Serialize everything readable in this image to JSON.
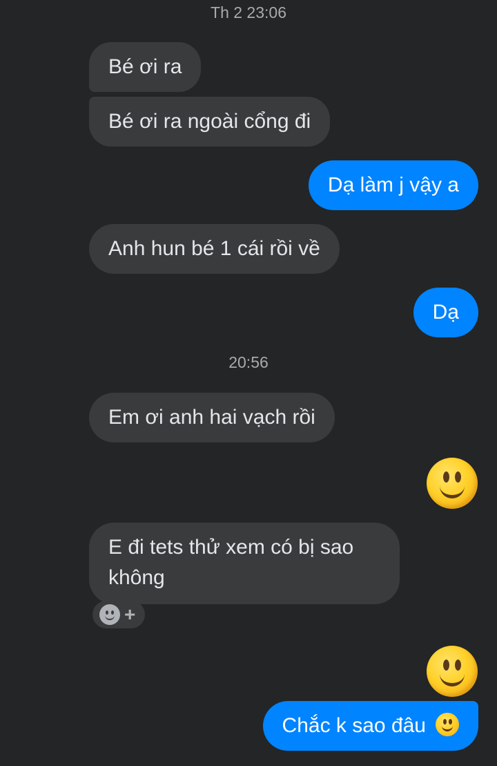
{
  "conversation": {
    "timestamps": [
      "Th 2 23:06",
      "20:56"
    ],
    "messages": [
      {
        "sender": "them",
        "text": "Bé ơi ra"
      },
      {
        "sender": "them",
        "text": "Bé ơi ra ngoài cổng đi"
      },
      {
        "sender": "me",
        "text": "Dạ làm j vậy a"
      },
      {
        "sender": "them",
        "text": "Anh hun bé 1 cái rồi về"
      },
      {
        "sender": "me",
        "text": "Dạ"
      },
      {
        "sender": "them",
        "text": "Em ơi anh hai vạch rồi"
      },
      {
        "sender": "me",
        "emoji": "slightly-smiling-face-icon"
      },
      {
        "sender": "them",
        "text": "E đi tets thử xem có bị sao không"
      },
      {
        "sender": "me",
        "emoji": "slightly-smiling-face-icon"
      },
      {
        "sender": "me",
        "text": "Chắc k sao đâu",
        "trailing_emoji": "slightly-smiling-face-icon"
      }
    ],
    "reaction_button": {
      "icon": "add-reaction-icon",
      "plus": "+"
    }
  },
  "colors": {
    "background": "#242526",
    "incoming_bubble": "#3a3b3c",
    "outgoing_bubble": "#0084ff",
    "timestamp_text": "#a8aaad"
  }
}
